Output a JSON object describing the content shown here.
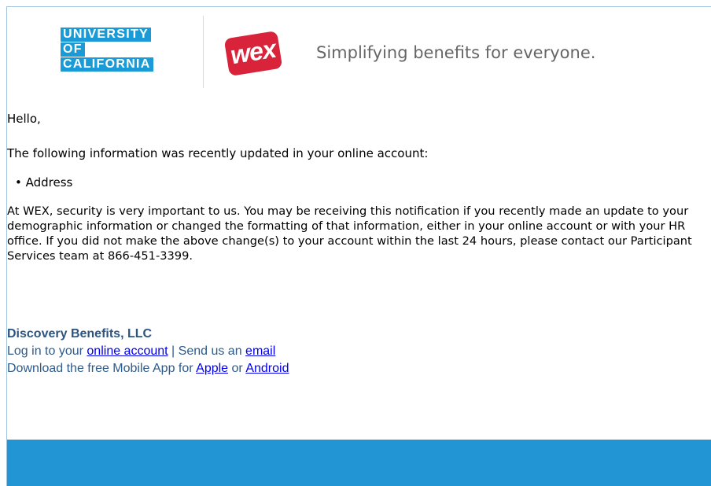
{
  "header": {
    "uc_logo_lines": [
      "UNIVERSITY",
      "OF",
      "CALIFORNIA"
    ],
    "wex_logo_text": "wex",
    "tagline": "Simplifying benefits for everyone."
  },
  "email": {
    "greeting": "Hello,",
    "intro": "The following information was recently updated in your online account:",
    "updated_items": [
      "Address"
    ],
    "security_notice": "At WEX, security is very important to us. You may be receiving this notification if you recently made an update to your demographic information or changed the formatting of that information, either in your online account or with your HR office. If you did not make the above change(s) to your account within the last 24 hours, please contact our Participant Services team at 866-451-3399."
  },
  "footer": {
    "company": "Discovery Benefits, LLC",
    "login_prefix": "Log in to your ",
    "online_account_link": "online account",
    "separator": " | Send us an ",
    "email_link": "email",
    "app_prefix": "Download the free Mobile App for ",
    "apple_link": "Apple",
    "or_text": " or ",
    "android_link": "Android"
  },
  "colors": {
    "uc_blue": "#1a9bd7",
    "wex_red": "#d8233a",
    "footer_text": "#2e5b8a",
    "band_blue": "#2296d4"
  }
}
